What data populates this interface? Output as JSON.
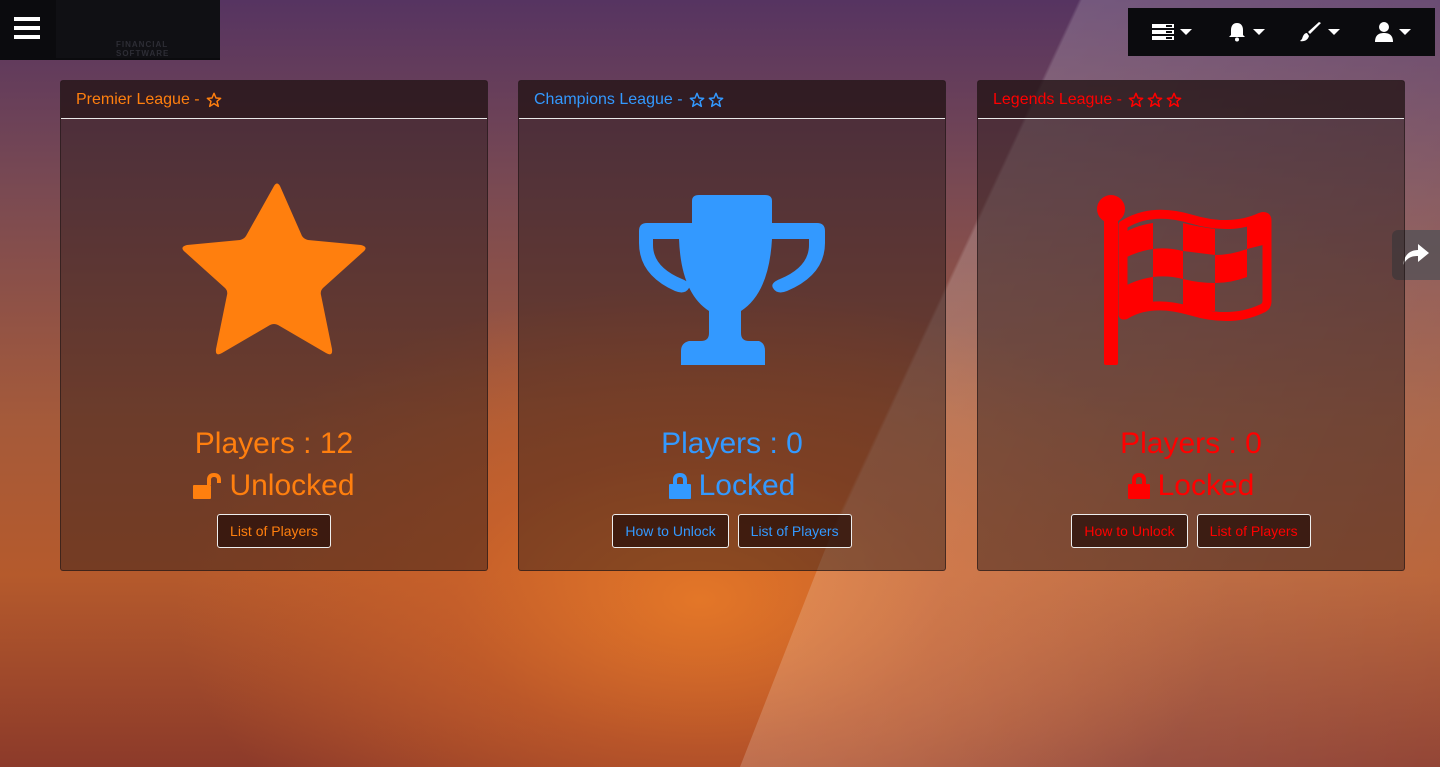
{
  "colors": {
    "premier": "#ff7f0e",
    "champions": "#3399ff",
    "legends": "#ff0000"
  },
  "header": {
    "logo_text": "FINANCIAL SOFTWARE",
    "icons": [
      "menu-icon",
      "server-icon",
      "bell-icon",
      "paint-brush-icon",
      "user-icon"
    ]
  },
  "cards": [
    {
      "title": "Premier League -",
      "stars": 1,
      "icon": "star-icon",
      "players": "Players : 12",
      "status": "Unlocked",
      "status_icon": "unlock-icon",
      "buttons": [
        "List of Players"
      ]
    },
    {
      "title": "Champions League -",
      "stars": 2,
      "icon": "trophy-icon",
      "players": "Players : 0",
      "status": "Locked",
      "status_icon": "lock-icon",
      "buttons": [
        "How to Unlock",
        "List of Players"
      ]
    },
    {
      "title": "Legends League -",
      "stars": 3,
      "icon": "checkered-flag-icon",
      "players": "Players : 0",
      "status": "Locked",
      "status_icon": "lock-icon",
      "buttons": [
        "How to Unlock",
        "List of Players"
      ]
    }
  ],
  "share_icon": "share-icon"
}
